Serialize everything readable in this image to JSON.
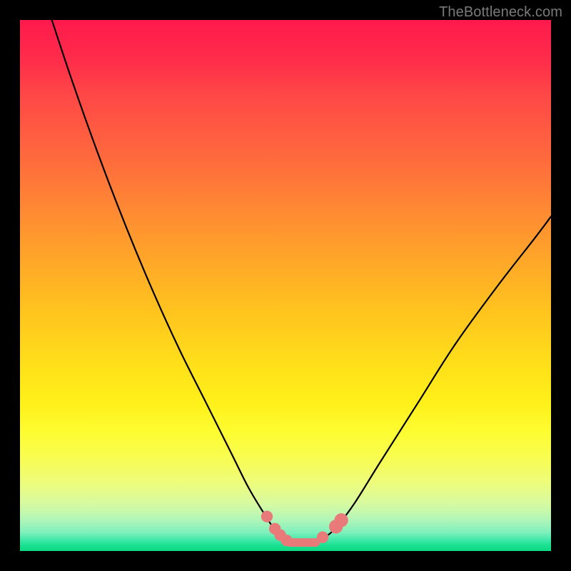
{
  "watermark": "TheBottleneck.com",
  "chart_data": {
    "type": "line",
    "title": "",
    "xlabel": "",
    "ylabel": "",
    "xlim": [
      0,
      100
    ],
    "ylim": [
      0,
      100
    ],
    "grid": false,
    "legend": false,
    "series": [
      {
        "name": "bottleneck-curve",
        "x": [
          6,
          10,
          15,
          20,
          25,
          30,
          35,
          40,
          43,
          46,
          48,
          50,
          52,
          54,
          56,
          58,
          60,
          63,
          68,
          75,
          82,
          90,
          97,
          100
        ],
        "y": [
          100,
          88,
          74,
          61,
          49,
          38,
          28,
          18,
          12,
          7,
          4,
          2,
          1.5,
          1.5,
          2,
          3,
          5,
          9,
          17,
          28,
          39,
          50,
          59,
          63
        ]
      }
    ],
    "markers": {
      "name": "highlight-dots",
      "color": "#e97a7a",
      "points": [
        {
          "x": 46.5,
          "y": 6.5,
          "r": 1.1
        },
        {
          "x": 48.0,
          "y": 4.2,
          "r": 1.1
        },
        {
          "x": 49.0,
          "y": 3.0,
          "r": 1.1
        },
        {
          "x": 50.2,
          "y": 2.0,
          "r": 1.1
        },
        {
          "x": 57.0,
          "y": 2.6,
          "r": 1.1
        },
        {
          "x": 59.5,
          "y": 4.6,
          "r": 1.3
        },
        {
          "x": 60.5,
          "y": 5.8,
          "r": 1.3
        }
      ],
      "bar": {
        "x0": 50.0,
        "x1": 56.5,
        "y": 1.6,
        "thickness": 1.6
      }
    },
    "background_gradient": {
      "top": "#ff1a4d",
      "mid": "#ffd31a",
      "bottom": "#18e08f"
    }
  }
}
